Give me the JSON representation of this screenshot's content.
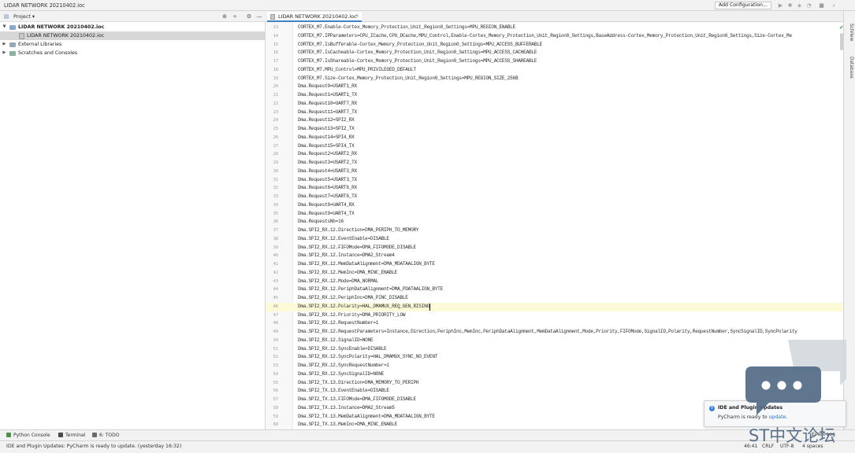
{
  "window": {
    "title": "LIDAR NETWORK 20210402.ioc"
  },
  "toolbar": {
    "run_config_label": "Add Configuration..."
  },
  "project_panel": {
    "title": "Project",
    "tree": [
      {
        "label": "LIDAR NETWORK 20210402.ioc",
        "kind": "folder",
        "expanded": true,
        "bold": true
      },
      {
        "label": "LIDAR NETWORK 20210402.ioc",
        "kind": "file",
        "selected": true
      },
      {
        "label": "External Libraries",
        "kind": "library"
      },
      {
        "label": "Scratches and Consoles",
        "kind": "scratch"
      }
    ]
  },
  "editor": {
    "tab_label": "LIDAR NETWORK 20210402.ioc",
    "current_line": 46,
    "lines": [
      {
        "n": 13,
        "text": "CORTEX_M7.Enable-Cortex_Memory_Protection_Unit_Region0_Settings=MPU_REGION_ENABLE"
      },
      {
        "n": 14,
        "text": "CORTEX_M7.IPParameters=CPU_ICache,CPU_DCache,MPU_Control,Enable-Cortex_Memory_Protection_Unit_Region0_Settings,BaseAddress-Cortex_Memory_Protection_Unit_Region0_Settings,Size-Cortex_Me"
      },
      {
        "n": 15,
        "text": "CORTEX_M7.IsBufferable-Cortex_Memory_Protection_Unit_Region0_Settings=MPU_ACCESS_BUFFERABLE"
      },
      {
        "n": 16,
        "text": "CORTEX_M7.IsCacheable-Cortex_Memory_Protection_Unit_Region0_Settings=MPU_ACCESS_CACHEABLE"
      },
      {
        "n": 17,
        "text": "CORTEX_M7.IsShareable-Cortex_Memory_Protection_Unit_Region0_Settings=MPU_ACCESS_SHAREABLE"
      },
      {
        "n": 18,
        "text": "CORTEX_M7.MPU_Control=MPU_PRIVILEGED_DEFAULT"
      },
      {
        "n": 19,
        "text": "CORTEX_M7.Size-Cortex_Memory_Protection_Unit_Region0_Settings=MPU_REGION_SIZE_256B"
      },
      {
        "n": 20,
        "text": "Dma.Request0=USART1_RX"
      },
      {
        "n": 21,
        "text": "Dma.Request1=USART1_TX"
      },
      {
        "n": 22,
        "text": "Dma.Request10=UART7_RX"
      },
      {
        "n": 23,
        "text": "Dma.Request11=UART7_TX"
      },
      {
        "n": 24,
        "text": "Dma.Request12=SPI2_RX"
      },
      {
        "n": 25,
        "text": "Dma.Request13=SPI2_TX"
      },
      {
        "n": 26,
        "text": "Dma.Request14=SPI4_RX"
      },
      {
        "n": 27,
        "text": "Dma.Request15=SPI4_TX"
      },
      {
        "n": 28,
        "text": "Dma.Request2=USART2_RX"
      },
      {
        "n": 29,
        "text": "Dma.Request3=USART2_TX"
      },
      {
        "n": 30,
        "text": "Dma.Request4=USART3_RX"
      },
      {
        "n": 31,
        "text": "Dma.Request5=USART3_TX"
      },
      {
        "n": 32,
        "text": "Dma.Request6=USART6_RX"
      },
      {
        "n": 33,
        "text": "Dma.Request7=USART6_TX"
      },
      {
        "n": 34,
        "text": "Dma.Request8=UART4_RX"
      },
      {
        "n": 35,
        "text": "Dma.Request9=UART4_TX"
      },
      {
        "n": 36,
        "text": "Dma.RequestsNb=16"
      },
      {
        "n": 37,
        "text": "Dma.SPI2_RX.12.Direction=DMA_PERIPH_TO_MEMORY"
      },
      {
        "n": 38,
        "text": "Dma.SPI2_RX.12.EventEnable=DISABLE"
      },
      {
        "n": 39,
        "text": "Dma.SPI2_RX.12.FIFOMode=DMA_FIFOMODE_DISABLE"
      },
      {
        "n": 40,
        "text": "Dma.SPI2_RX.12.Instance=DMA2_Stream4"
      },
      {
        "n": 41,
        "text": "Dma.SPI2_RX.12.MemDataAlignment=DMA_MDATAALIGN_BYTE"
      },
      {
        "n": 42,
        "text": "Dma.SPI2_RX.12.MemInc=DMA_MINC_ENABLE"
      },
      {
        "n": 43,
        "text": "Dma.SPI2_RX.12.Mode=DMA_NORMAL"
      },
      {
        "n": 44,
        "text": "Dma.SPI2_RX.12.PeriphDataAlignment=DMA_PDATAALIGN_BYTE"
      },
      {
        "n": 45,
        "text": "Dma.SPI2_RX.12.PeriphInc=DMA_PINC_DISABLE"
      },
      {
        "n": 46,
        "text": "Dma.SPI2_RX.12.Polarity=HAL_DMAMUX_REQ_GEN_RISING"
      },
      {
        "n": 47,
        "text": "Dma.SPI2_RX.12.Priority=DMA_PRIORITY_LOW"
      },
      {
        "n": 48,
        "text": "Dma.SPI2_RX.12.RequestNumber=1"
      },
      {
        "n": 49,
        "text": "Dma.SPI2_RX.12.RequestParameters=Instance,Direction,PeriphInc,MemInc,PeriphDataAlignment,MemDataAlignment,Mode,Priority,FIFOMode,SignalID,Polarity,RequestNumber,SyncSignalID,SyncPolarity"
      },
      {
        "n": 50,
        "text": "Dma.SPI2_RX.12.SignalID=NONE"
      },
      {
        "n": 51,
        "text": "Dma.SPI2_RX.12.SyncEnable=DISABLE"
      },
      {
        "n": 52,
        "text": "Dma.SPI2_RX.12.SyncPolarity=HAL_DMAMUX_SYNC_NO_EVENT"
      },
      {
        "n": 53,
        "text": "Dma.SPI2_RX.12.SyncRequestNumber=1"
      },
      {
        "n": 54,
        "text": "Dma.SPI2_RX.12.SyncSignalID=NONE"
      },
      {
        "n": 55,
        "text": "Dma.SPI2_TX.13.Direction=DMA_MEMORY_TO_PERIPH"
      },
      {
        "n": 56,
        "text": "Dma.SPI2_TX.13.EventEnable=DISABLE"
      },
      {
        "n": 57,
        "text": "Dma.SPI2_TX.13.FIFOMode=DMA_FIFOMODE_DISABLE"
      },
      {
        "n": 58,
        "text": "Dma.SPI2_TX.13.Instance=DMA2_Stream5"
      },
      {
        "n": 59,
        "text": "Dma.SPI2_TX.13.MemDataAlignment=DMA_MDATAALIGN_BYTE"
      },
      {
        "n": 60,
        "text": "Dma.SPI2_TX.13.MemInc=DMA_MINC_ENABLE"
      }
    ]
  },
  "right_strip": {
    "tabs": [
      "SciView",
      "Database"
    ]
  },
  "bottom_tools": [
    {
      "label": "Python Console",
      "color": "#4f8f4f"
    },
    {
      "label": "Terminal",
      "color": "#4b4b4b"
    },
    {
      "label": "6: TODO",
      "color": "#6b6b6b"
    }
  ],
  "event_log": {
    "label": "Event Log"
  },
  "status": {
    "message": "IDE and Plugin Updates: PyCharm is ready to update. (yesterday 16:32)",
    "position": "46:41",
    "line_separator": "CRLF",
    "encoding": "UTF-8",
    "indent": "4 spaces"
  },
  "notification": {
    "title": "IDE and Plugin Updates",
    "body": "PyCharm is ready to",
    "link": "update."
  },
  "watermark": {
    "text": "ST中文论坛"
  },
  "colors": {
    "accent": "#4083c9",
    "link": "#2a6fc9",
    "current_line": "#fcfad8",
    "selection": "#d7d7d7",
    "watermark": "#536a85"
  }
}
